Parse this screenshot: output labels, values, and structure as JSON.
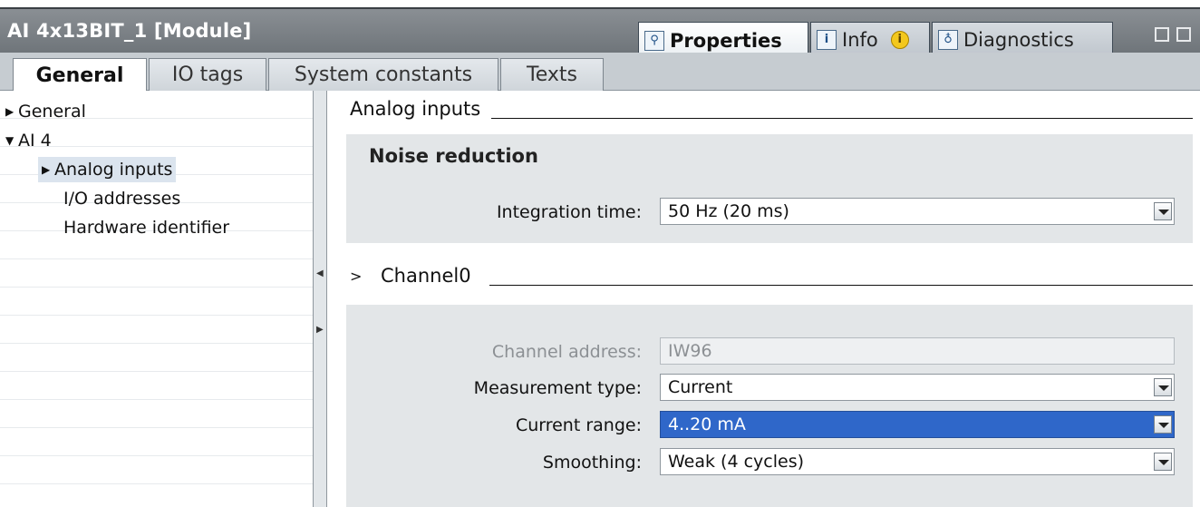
{
  "window": {
    "title": "AI 4x13BIT_1 [Module]",
    "tabs": [
      {
        "label": "Properties",
        "icon": "properties-icon",
        "active": true
      },
      {
        "label": "Info",
        "icon": "info-icon",
        "active": false
      },
      {
        "label": "Diagnostics",
        "icon": "diagnostics-icon",
        "active": false
      }
    ],
    "info_badge": "i"
  },
  "tabs": [
    {
      "label": "General",
      "active": true
    },
    {
      "label": "IO tags",
      "active": false
    },
    {
      "label": "System constants",
      "active": false
    },
    {
      "label": "Texts",
      "active": false
    }
  ],
  "nav": {
    "items": [
      {
        "label": "General",
        "expander": "collapsed"
      },
      {
        "label": "AI 4",
        "expander": "expanded"
      },
      {
        "label": "Analog inputs",
        "expander": "collapsed",
        "selected": true
      },
      {
        "label": "I/O addresses"
      },
      {
        "label": "Hardware identifier"
      }
    ]
  },
  "content": {
    "section_title": "Analog inputs",
    "noise": {
      "title": "Noise reduction",
      "integration_label": "Integration time:",
      "integration_value": "50 Hz (20 ms)"
    },
    "channel": {
      "title": "Channel0",
      "expander": ">",
      "address_label": "Channel address:",
      "address_value": "IW96",
      "measurement_label": "Measurement type:",
      "measurement_value": "Current",
      "range_label": "Current range:",
      "range_value": "4..20 mA",
      "smoothing_label": "Smoothing:",
      "smoothing_value": "Weak (4 cycles)"
    }
  },
  "colors": {
    "titlebar": "#7b8085",
    "highlight": "#2f67c9",
    "panel": "#e3e6e8"
  }
}
